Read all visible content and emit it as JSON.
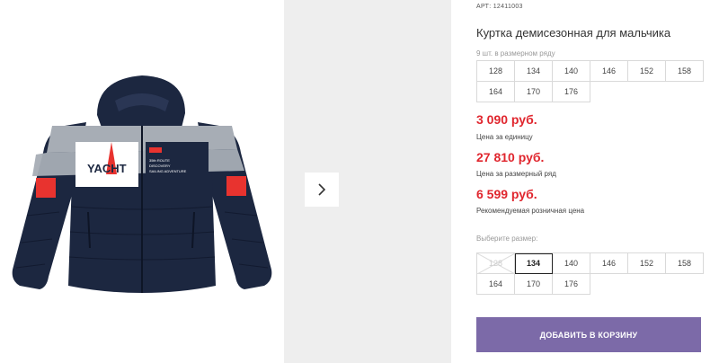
{
  "product": {
    "art_label": "АРТ:",
    "art_value": "12411003",
    "title": "Куртка демисезонная для мальчика",
    "pack_count": "9 шт. в размерном ряду",
    "pack_sizes": [
      "128",
      "134",
      "140",
      "146",
      "152",
      "158",
      "164",
      "170",
      "176"
    ]
  },
  "prices": [
    {
      "value": "3 090 руб.",
      "note": "Цена за единицу"
    },
    {
      "value": "27 810 руб.",
      "note": "Цена за размерный ряд"
    },
    {
      "value": "6 599 руб.",
      "note": "Рекомендуемая розничная цена"
    }
  ],
  "size_select": {
    "label": "Выберите размер:",
    "sizes": [
      {
        "label": "128",
        "state": "disabled"
      },
      {
        "label": "134",
        "state": "selected"
      },
      {
        "label": "140",
        "state": "normal"
      },
      {
        "label": "146",
        "state": "normal"
      },
      {
        "label": "152",
        "state": "normal"
      },
      {
        "label": "158",
        "state": "normal"
      },
      {
        "label": "164",
        "state": "normal"
      },
      {
        "label": "170",
        "state": "normal"
      },
      {
        "label": "176",
        "state": "normal"
      }
    ]
  },
  "cart_button": {
    "label": "ДОБАВИТЬ В КОРЗИНУ"
  },
  "jacket_print": {
    "logo": "YACHT",
    "patch_line1": "35th ROUTE",
    "patch_line2": "DISCOVERY",
    "patch_line3": "SAILING ADVENTURE"
  },
  "icons": {
    "next": "chevron-right-icon"
  },
  "colors": {
    "price": "#e0262e",
    "button": "#7c6aa8",
    "jacket_navy": "#1c2740",
    "jacket_red": "#e8332f"
  }
}
